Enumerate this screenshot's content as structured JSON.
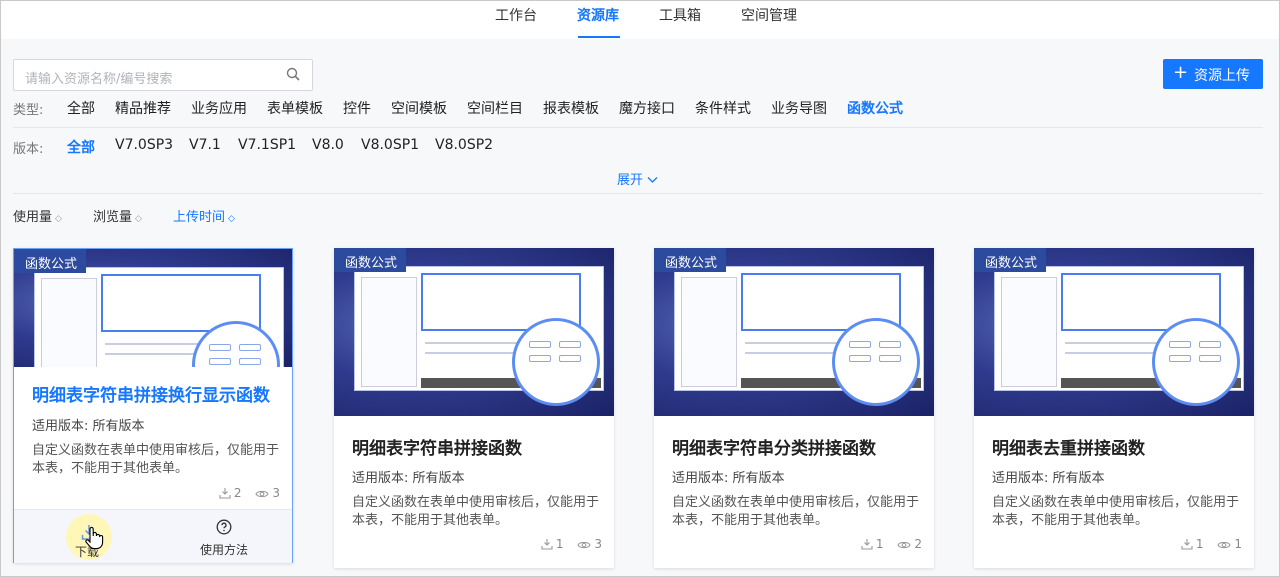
{
  "topnav": {
    "tabs": [
      {
        "label": "工作台",
        "active": false
      },
      {
        "label": "资源库",
        "active": true
      },
      {
        "label": "工具箱",
        "active": false
      },
      {
        "label": "空间管理",
        "active": false
      }
    ]
  },
  "search": {
    "placeholder": "请输入资源名称/编号搜索"
  },
  "upload": {
    "label": "资源上传"
  },
  "type_filter": {
    "label": "类型:",
    "options": [
      "全部",
      "精品推荐",
      "业务应用",
      "表单模板",
      "控件",
      "空间模板",
      "空间栏目",
      "报表模板",
      "魔方接口",
      "条件样式",
      "业务导图",
      "函数公式"
    ],
    "active": "函数公式"
  },
  "version_filter": {
    "label": "版本:",
    "options": [
      "全部",
      "V7.0SP3",
      "V7.1",
      "V7.1SP1",
      "V8.0",
      "V8.0SP1",
      "V8.0SP2"
    ],
    "active": "全部"
  },
  "expand": {
    "label": "展开"
  },
  "sort": {
    "options": [
      "使用量",
      "浏览量",
      "上传时间"
    ],
    "active": "上传时间"
  },
  "cards": [
    {
      "tag": "函数公式",
      "title": "明细表字符串拼接换行显示函数",
      "version": "适用版本:  所有版本",
      "desc": "自定义函数在表单中使用审核后，仅能用于本表，不能用于其他表单。",
      "downloads": "2",
      "views": "3",
      "hover": true,
      "actions": {
        "download": "下载",
        "usage": "使用方法"
      }
    },
    {
      "tag": "函数公式",
      "title": "明细表字符串拼接函数",
      "version": "适用版本:  所有版本",
      "desc": "自定义函数在表单中使用审核后，仅能用于本表，不能用于其他表单。",
      "downloads": "1",
      "views": "3"
    },
    {
      "tag": "函数公式",
      "title": "明细表字符串分类拼接函数",
      "version": "适用版本:  所有版本",
      "desc": "自定义函数在表单中使用审核后，仅能用于本表，不能用于其他表单。",
      "downloads": "1",
      "views": "2"
    },
    {
      "tag": "函数公式",
      "title": "明细表去重拼接函数",
      "version": "适用版本:  所有版本",
      "desc": "自定义函数在表单中使用审核后，仅能用于本表，不能用于其他表单。",
      "downloads": "1",
      "views": "1"
    }
  ],
  "colors": {
    "accent": "#1677ff",
    "tag_bg": "#2c4a9e"
  },
  "icons": [
    "search-icon",
    "plus-icon",
    "chevron-down-icon",
    "sort-icon",
    "download-icon",
    "eye-icon",
    "help-circle-icon",
    "hand-cursor-icon"
  ]
}
